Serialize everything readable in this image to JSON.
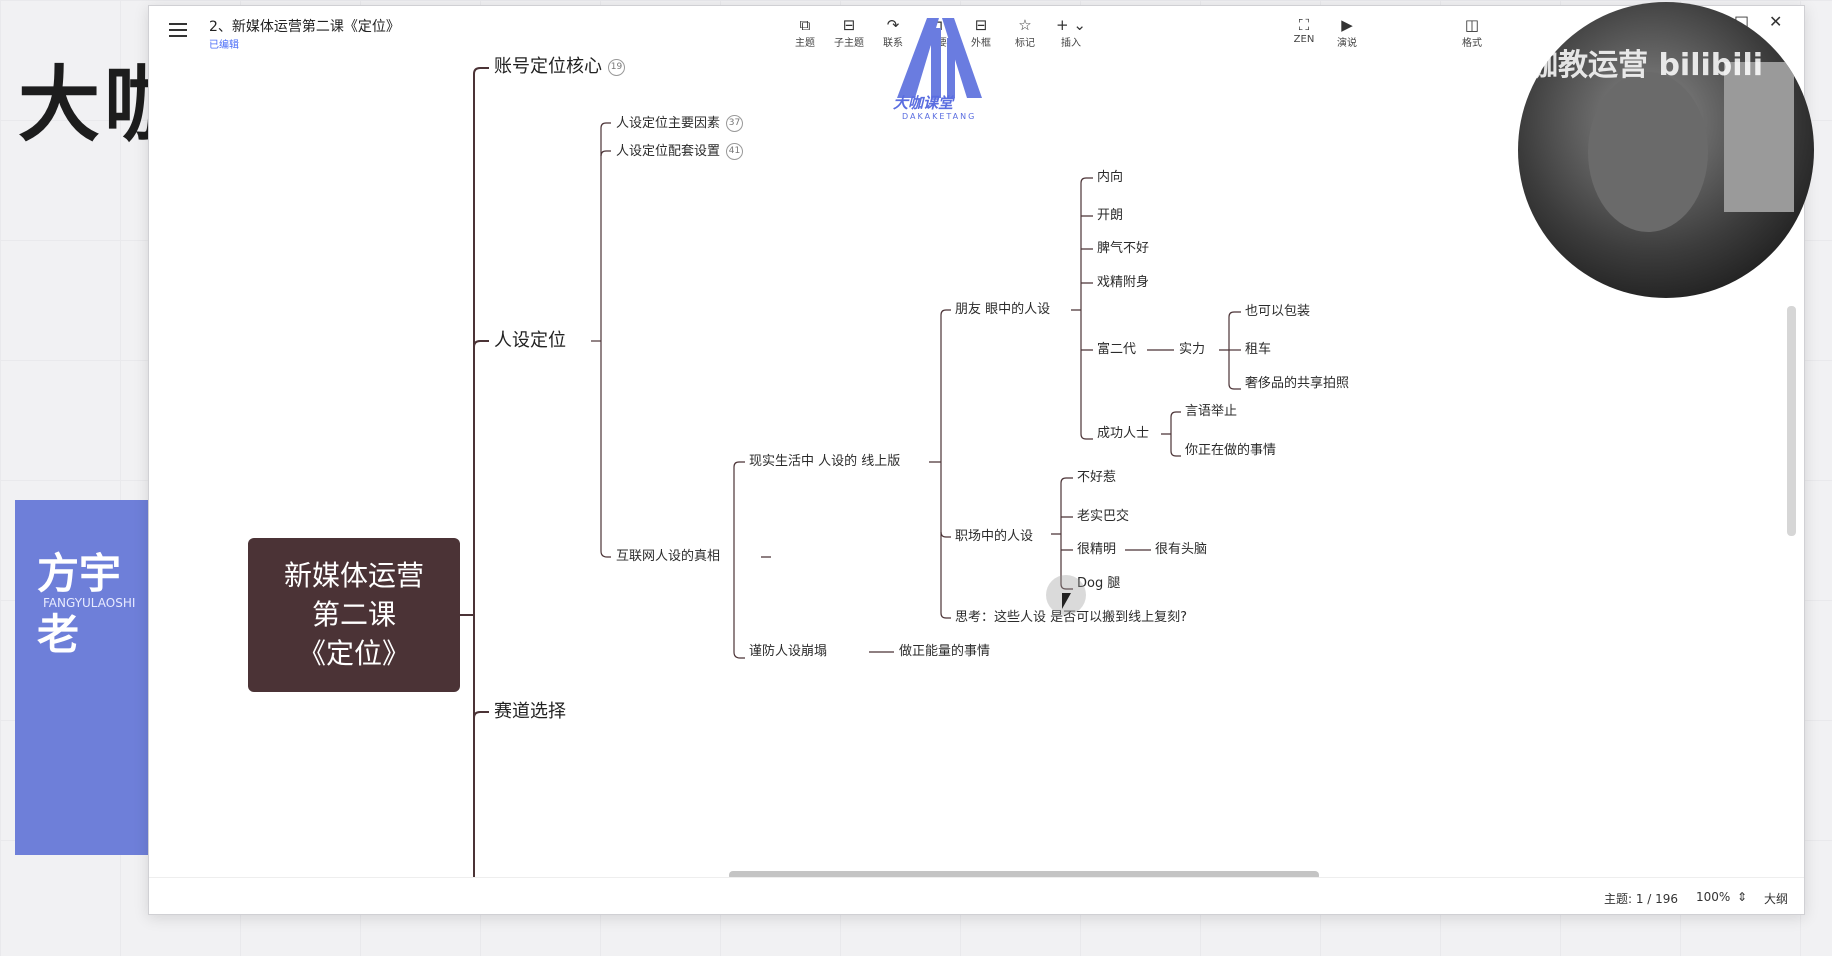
{
  "background": {
    "title": "大咖",
    "card_name": "方宇老",
    "card_sub": "FANGYULAOSHI"
  },
  "window": {
    "doc_title": "2、新媒体运营第二课《定位》",
    "doc_status": "已编辑",
    "toolbar": [
      {
        "name": "topic",
        "label": "主题",
        "icon": "⧉"
      },
      {
        "name": "subtopic",
        "label": "子主题",
        "icon": "⊟"
      },
      {
        "name": "relation",
        "label": "联系",
        "icon": "↷"
      },
      {
        "name": "summary",
        "label": "概要",
        "icon": "⊐"
      },
      {
        "name": "boundary",
        "label": "外框",
        "icon": "⊟"
      },
      {
        "name": "marker",
        "label": "标记",
        "icon": "☆"
      },
      {
        "name": "insert",
        "label": "插入",
        "icon": "+ ⌄"
      },
      {
        "name": "zen",
        "label": "ZEN",
        "icon": "⛶"
      },
      {
        "name": "present",
        "label": "演说",
        "icon": "▶"
      },
      {
        "name": "format",
        "label": "格式",
        "icon": "◫"
      }
    ],
    "window_controls": {
      "minimize": "—",
      "maximize": "□",
      "close": "✕"
    }
  },
  "logo": {
    "text": "大咖课堂",
    "sub": "DAKAKETANG"
  },
  "watermark": "大咖教运营 bilibili",
  "mindmap": {
    "root": [
      "新媒体运营",
      "第二课",
      "《定位》"
    ],
    "nodes": [
      {
        "id": "n1",
        "text": "账号定位核心",
        "count": "19"
      },
      {
        "id": "n2",
        "text": "人设定位"
      },
      {
        "id": "n3",
        "text": "赛道选择"
      },
      {
        "id": "n21",
        "text": "人设定位主要因素",
        "count": "37"
      },
      {
        "id": "n22",
        "text": "人设定位配套设置",
        "count": "41"
      },
      {
        "id": "n23",
        "text": "互联网人设的真相"
      },
      {
        "id": "n231",
        "text": "现实生活中 人设的 线上版"
      },
      {
        "id": "n232",
        "text": "谨防人设崩塌"
      },
      {
        "id": "n2321",
        "text": "做正能量的事情"
      },
      {
        "id": "f",
        "text": "朋友 眼中的人设"
      },
      {
        "id": "w",
        "text": "职场中的人设"
      },
      {
        "id": "t",
        "text": "思考：这些人设 是否可以搬到线上复刻?"
      },
      {
        "id": "f1",
        "text": "内向"
      },
      {
        "id": "f2",
        "text": "开朗"
      },
      {
        "id": "f3",
        "text": "脾气不好"
      },
      {
        "id": "f4",
        "text": "戏精附身"
      },
      {
        "id": "f5",
        "text": "富二代"
      },
      {
        "id": "f6",
        "text": "成功人士"
      },
      {
        "id": "f51",
        "text": "实力"
      },
      {
        "id": "f511",
        "text": "也可以包装"
      },
      {
        "id": "f512",
        "text": "租车"
      },
      {
        "id": "f513",
        "text": "奢侈品的共享拍照"
      },
      {
        "id": "f61",
        "text": "言语举止"
      },
      {
        "id": "f62",
        "text": "你正在做的事情"
      },
      {
        "id": "w1",
        "text": "不好惹"
      },
      {
        "id": "w2",
        "text": "老实巴交"
      },
      {
        "id": "w3",
        "text": "很精明"
      },
      {
        "id": "w4",
        "text": "Dog 腿"
      },
      {
        "id": "w31",
        "text": "很有头脑"
      }
    ]
  },
  "status": {
    "topic_count": "主题: 1 / 196",
    "zoom": "100%",
    "outline": "大纲"
  }
}
